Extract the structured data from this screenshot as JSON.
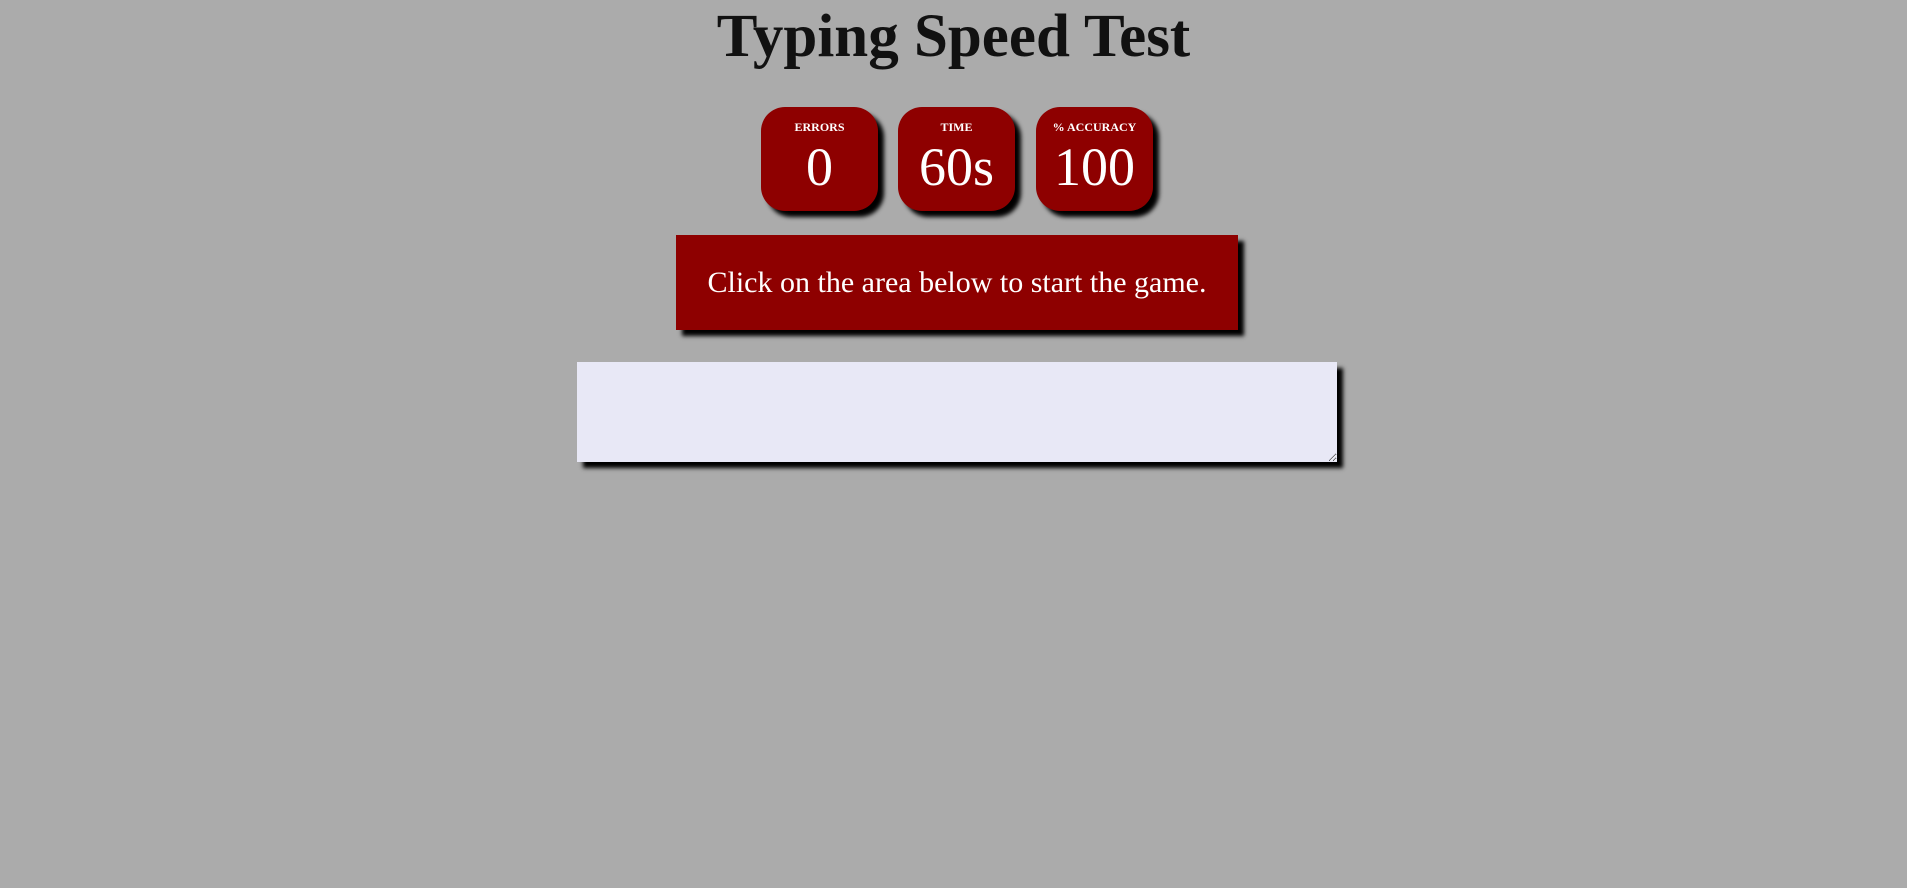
{
  "header": {
    "title": "Typing Speed Test"
  },
  "stats": {
    "errors": {
      "label": "ERRORS",
      "value": "0"
    },
    "time": {
      "label": "TIME",
      "value": "60s"
    },
    "accuracy": {
      "label": "% ACCURACY",
      "value": "100"
    }
  },
  "quote": {
    "text": "Click on the area below to start the game."
  },
  "input": {
    "value": "",
    "placeholder": ""
  },
  "colors": {
    "background": "#ababab",
    "accent": "#8e0000",
    "input_background": "#e8e8f6",
    "title_text": "#111111"
  }
}
